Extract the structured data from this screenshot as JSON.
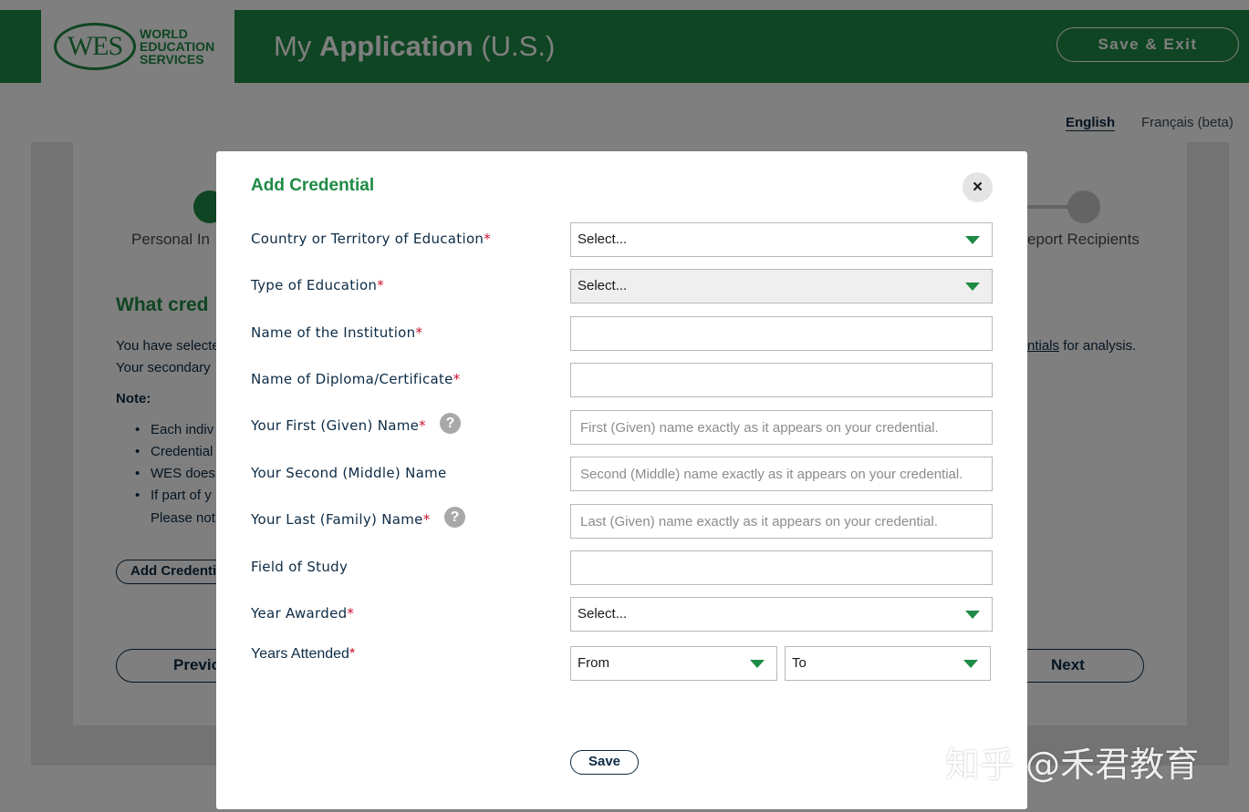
{
  "header": {
    "logo_abbr": "WES",
    "logo_lines": [
      "WORLD",
      "EDUCATION",
      "SERVICES"
    ],
    "title_pre": "My ",
    "title_bold": "Application",
    "title_post": " (U.S.)",
    "save_exit_label": "Save & Exit",
    "brand_color": "#1f8a45"
  },
  "language": {
    "english": "English",
    "french": "Français (beta)"
  },
  "background_page": {
    "step_1_label": "Personal In",
    "step_last_label": "eport Recipients",
    "heading": "What cred",
    "line_1": "You have selecte",
    "line_2": "Your secondary",
    "right_text_link": "ntials",
    "right_text_rest": " for analysis.",
    "note_label": "Note:",
    "bullets": [
      "Each indiv",
      "Credential",
      "WES does",
      "If part of y",
      "Please not"
    ],
    "add_credential_label": "Add Credential",
    "previous_label": "Previous",
    "next_label": "Next"
  },
  "modal": {
    "title": "Add Credential",
    "close_icon": "×",
    "help_icon": "?",
    "fields": {
      "country": {
        "label": "Country or Territory of Education",
        "value": "Select..."
      },
      "education_type": {
        "label": "Type of Education",
        "value": "Select..."
      },
      "institution": {
        "label": "Name of the Institution",
        "value": ""
      },
      "diploma": {
        "label": "Name of Diploma/Certificate",
        "value": ""
      },
      "first_name": {
        "label": "Your First (Given) Name",
        "placeholder": "First (Given) name exactly as it appears on your credential."
      },
      "middle_name": {
        "label": "Your Second (Middle) Name",
        "placeholder": "Second (Middle) name exactly as it appears on your credential."
      },
      "last_name": {
        "label": "Your Last (Family) Name",
        "placeholder": "Last (Given) name exactly as it appears on your credential."
      },
      "field_of_study": {
        "label": "Field of Study",
        "value": ""
      },
      "year_awarded": {
        "label": "Year Awarded",
        "value": "Select..."
      },
      "years_attended": {
        "label": "Years Attended",
        "from": "From",
        "to": "To"
      }
    },
    "required_mark": "*",
    "save_label": "Save"
  },
  "watermark": "知乎 @禾君教育"
}
